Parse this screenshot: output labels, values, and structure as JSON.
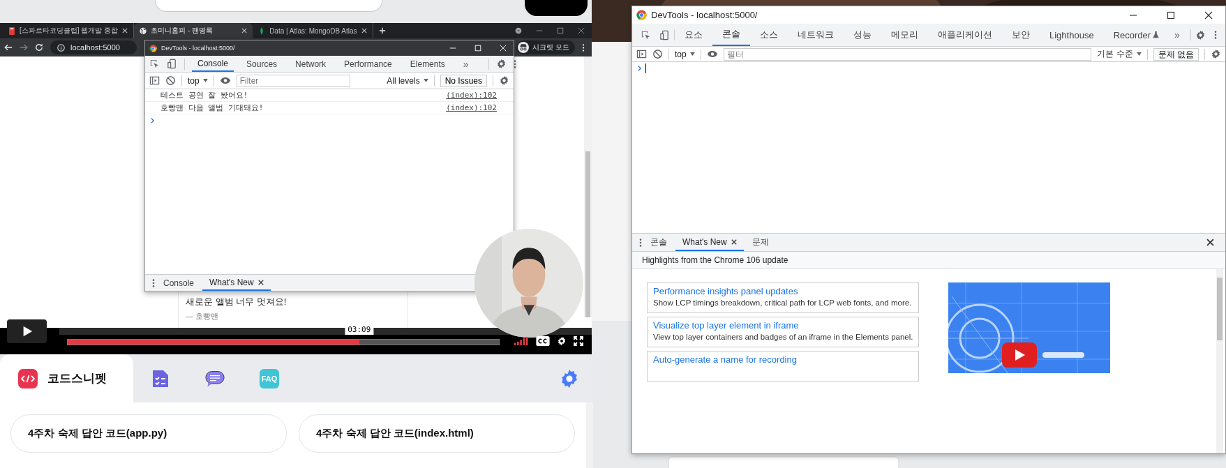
{
  "browser": {
    "tabs": [
      {
        "kind": "book",
        "title": "[스파르타코딩클럽] 웹개발 종합",
        "selected": false
      },
      {
        "kind": "globe",
        "title": "초미니홈피 - 팬명록",
        "selected": true
      },
      {
        "kind": "leaf",
        "title": "Data | Atlas: MongoDB Atlas",
        "selected": false
      }
    ],
    "address": "localhost:5000",
    "incognito": "시크릿 모드",
    "page": {
      "comment": "새로운 앨범 너무 멋져요!",
      "author": "— 호빵맨"
    },
    "video": {
      "time": "03:09",
      "level": 0.676
    },
    "devtools": {
      "title": "DevTools - localhost:5000/",
      "tabs": [
        {
          "label": "Console",
          "selected": true
        },
        {
          "label": "Sources",
          "selected": false
        },
        {
          "label": "Network",
          "selected": false
        },
        {
          "label": "Performance",
          "selected": false
        },
        {
          "label": "Elements",
          "selected": false
        }
      ],
      "more_tabs": "»",
      "context": "top",
      "filter_placeholder": "Filter",
      "levels": "All levels",
      "issues": "No Issues",
      "messages": [
        {
          "text": "테스트 공연 잘 봤어요!",
          "source": "(index):102"
        },
        {
          "text": "호빵맨 다음 앨범 기대돼요!",
          "source": "(index):102"
        }
      ],
      "drawer_tabs": [
        {
          "label": "Console",
          "selected": false,
          "closable": false
        },
        {
          "label": "What's New",
          "selected": true,
          "closable": true
        }
      ]
    }
  },
  "snippets": {
    "tabs": [
      {
        "kind": "code",
        "label": "코드스니펫",
        "selected": true
      },
      {
        "kind": "checklist",
        "selected": false
      },
      {
        "kind": "chat",
        "selected": false
      },
      {
        "kind": "faq",
        "label": "FAQ",
        "selected": false
      }
    ],
    "buttons": [
      "4주차 숙제 답안 코드(app.py)",
      "4주차 숙제 답안 코드(index.html)"
    ]
  },
  "devtools": {
    "title": "DevTools - localhost:5000/",
    "tabs": [
      {
        "label": "요소",
        "selected": false,
        "experimental": false
      },
      {
        "label": "콘솔",
        "selected": true,
        "experimental": false
      },
      {
        "label": "소스",
        "selected": false,
        "experimental": false
      },
      {
        "label": "네트워크",
        "selected": false,
        "experimental": false
      },
      {
        "label": "성능",
        "selected": false,
        "experimental": false
      },
      {
        "label": "메모리",
        "selected": false,
        "experimental": false
      },
      {
        "label": "애플리케이션",
        "selected": false,
        "experimental": false
      },
      {
        "label": "보안",
        "selected": false,
        "experimental": false
      },
      {
        "label": "Lighthouse",
        "selected": false,
        "experimental": false
      },
      {
        "label": "Recorder",
        "selected": false,
        "experimental": true
      }
    ],
    "more_tabs": "»",
    "context": "top",
    "filter_placeholder": "필터",
    "levels": "기본 수준",
    "issues": "문제 없음",
    "drawer_tabs": [
      {
        "label": "콘솔",
        "selected": false,
        "closable": false
      },
      {
        "label": "What's New",
        "selected": true,
        "closable": true
      },
      {
        "label": "문제",
        "selected": false,
        "closable": false
      }
    ],
    "highlights": "Highlights from the Chrome 106 update",
    "cards": [
      {
        "title": "Performance insights panel updates",
        "description": "Show LCP timings breakdown, critical path for LCP web fonts, and more."
      },
      {
        "title": "Visualize top layer element in iframe",
        "description": "View top layer containers and badges of an iframe in the Elements panel."
      },
      {
        "title": "Auto-generate a name for recording"
      }
    ]
  }
}
